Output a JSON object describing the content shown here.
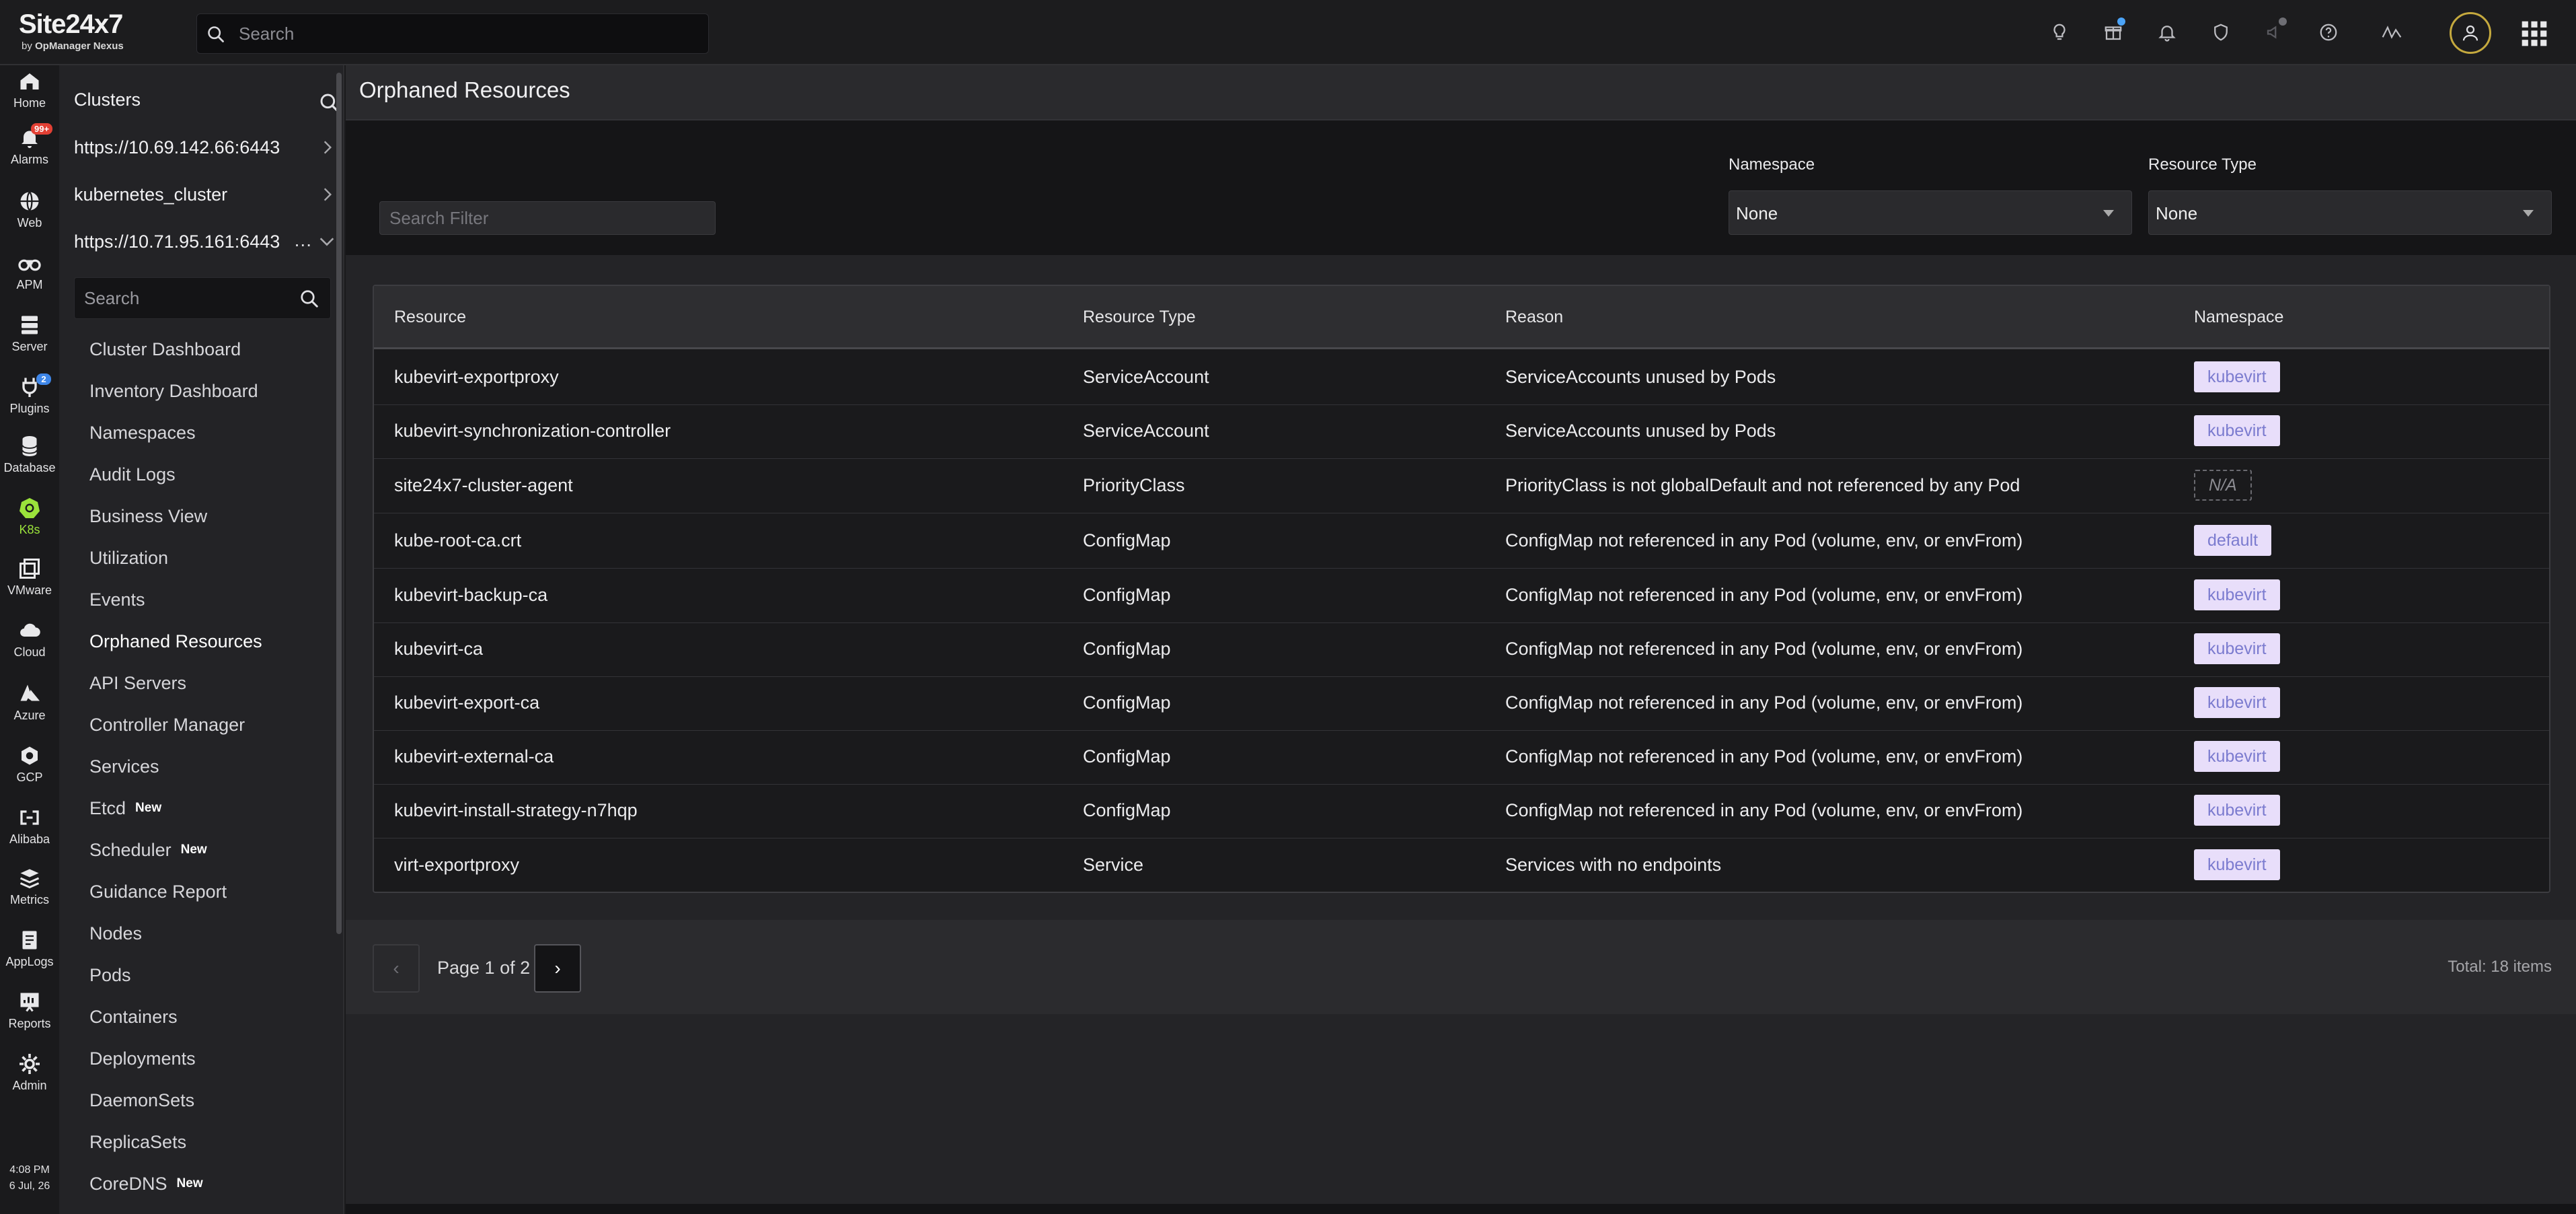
{
  "brand": {
    "name_a": "Site",
    "name_b": "24x7",
    "sub_prefix": "by ",
    "sub_strong": "OpManager Nexus"
  },
  "topbar": {
    "search_placeholder": "Search",
    "icons": [
      "bulb-icon",
      "gift-icon",
      "bell-icon",
      "shield-icon",
      "megaphone-icon",
      "help-icon",
      "zia-icon"
    ]
  },
  "rail": {
    "items": [
      {
        "label": "Home",
        "icon": "home-icon"
      },
      {
        "label": "Alarms",
        "icon": "bell-icon",
        "badge": "99+"
      },
      {
        "label": "Web",
        "icon": "globe-icon"
      },
      {
        "label": "APM",
        "icon": "binoculars-icon"
      },
      {
        "label": "Server",
        "icon": "server-icon"
      },
      {
        "label": "Plugins",
        "icon": "plug-icon",
        "badge": "2"
      },
      {
        "label": "Database",
        "icon": "database-icon"
      },
      {
        "label": "K8s",
        "icon": "k8s-icon"
      },
      {
        "label": "VMware",
        "icon": "vmware-icon"
      },
      {
        "label": "Cloud",
        "icon": "cloud-icon"
      },
      {
        "label": "Azure",
        "icon": "azure-icon"
      },
      {
        "label": "GCP",
        "icon": "gcp-icon"
      },
      {
        "label": "Alibaba",
        "icon": "alibaba-icon"
      },
      {
        "label": "Metrics",
        "icon": "metrics-icon"
      },
      {
        "label": "AppLogs",
        "icon": "applogs-icon"
      },
      {
        "label": "Reports",
        "icon": "reports-icon"
      },
      {
        "label": "Admin",
        "icon": "gear-icon"
      }
    ],
    "time": "4:08 PM",
    "date": "6 Jul, 26"
  },
  "sidebar": {
    "header": "Clusters",
    "clusters": [
      "https://10.69.142.66:6443",
      "kubernetes_cluster",
      "https://10.71.95.161:6443"
    ],
    "more": "...",
    "search_placeholder": "Search",
    "nav": [
      {
        "label": "Cluster Dashboard"
      },
      {
        "label": "Inventory Dashboard"
      },
      {
        "label": "Namespaces"
      },
      {
        "label": "Audit Logs"
      },
      {
        "label": "Business View"
      },
      {
        "label": "Utilization"
      },
      {
        "label": "Events"
      },
      {
        "label": "Orphaned Resources"
      },
      {
        "label": "API Servers"
      },
      {
        "label": "Controller Manager"
      },
      {
        "label": "Services"
      },
      {
        "label": "Etcd",
        "badge": "New"
      },
      {
        "label": "Scheduler",
        "badge": "New"
      },
      {
        "label": "Guidance Report"
      },
      {
        "label": "Nodes"
      },
      {
        "label": "Pods"
      },
      {
        "label": "Containers"
      },
      {
        "label": "Deployments"
      },
      {
        "label": "DaemonSets"
      },
      {
        "label": "ReplicaSets"
      },
      {
        "label": "CoreDNS",
        "badge": "New"
      }
    ]
  },
  "main": {
    "title": "Orphaned Resources",
    "search_filter_placeholder": "Search Filter",
    "namespace_label": "Namespace",
    "namespace_value": "None",
    "resource_type_label": "Resource Type",
    "resource_type_value": "None",
    "columns": [
      "Resource",
      "Resource Type",
      "Reason",
      "Namespace"
    ],
    "rows": [
      {
        "resource": "kubevirt-exportproxy",
        "type": "ServiceAccount",
        "reason": "ServiceAccounts unused by Pods",
        "namespace": "kubevirt"
      },
      {
        "resource": "kubevirt-synchronization-controller",
        "type": "ServiceAccount",
        "reason": "ServiceAccounts unused by Pods",
        "namespace": "kubevirt"
      },
      {
        "resource": "site24x7-cluster-agent",
        "type": "PriorityClass",
        "reason": "PriorityClass is not globalDefault and not referenced by any Pod",
        "namespace": "N/A"
      },
      {
        "resource": "kube-root-ca.crt",
        "type": "ConfigMap",
        "reason": "ConfigMap not referenced in any Pod (volume, env, or envFrom)",
        "namespace": "default"
      },
      {
        "resource": "kubevirt-backup-ca",
        "type": "ConfigMap",
        "reason": "ConfigMap not referenced in any Pod (volume, env, or envFrom)",
        "namespace": "kubevirt"
      },
      {
        "resource": "kubevirt-ca",
        "type": "ConfigMap",
        "reason": "ConfigMap not referenced in any Pod (volume, env, or envFrom)",
        "namespace": "kubevirt"
      },
      {
        "resource": "kubevirt-export-ca",
        "type": "ConfigMap",
        "reason": "ConfigMap not referenced in any Pod (volume, env, or envFrom)",
        "namespace": "kubevirt"
      },
      {
        "resource": "kubevirt-external-ca",
        "type": "ConfigMap",
        "reason": "ConfigMap not referenced in any Pod (volume, env, or envFrom)",
        "namespace": "kubevirt"
      },
      {
        "resource": "kubevirt-install-strategy-n7hqp",
        "type": "ConfigMap",
        "reason": "ConfigMap not referenced in any Pod (volume, env, or envFrom)",
        "namespace": "kubevirt"
      },
      {
        "resource": "virt-exportproxy",
        "type": "Service",
        "reason": "Services with no endpoints",
        "namespace": "kubevirt"
      }
    ],
    "pager": {
      "prev": "‹",
      "next": "›",
      "page_text": "Page 1 of 2",
      "total": "Total: 18 items"
    }
  },
  "colors": {
    "accent_k8s": "#9be33b",
    "tag_bg": "#e8defa",
    "tag_fg": "#7b7bcf",
    "badge_red": "#e24034",
    "badge_blue": "#3e86e8"
  }
}
